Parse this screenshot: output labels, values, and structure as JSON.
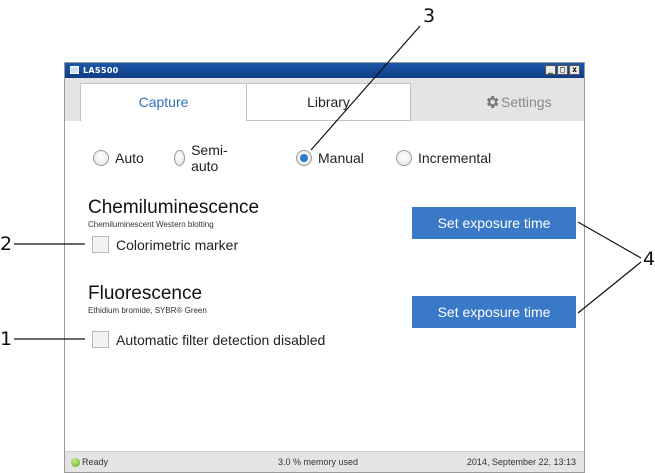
{
  "window": {
    "title": "LAS500",
    "controls": [
      "_",
      "□",
      "x"
    ]
  },
  "tabs": {
    "capture": "Capture",
    "library": "Library",
    "settings": "Settings"
  },
  "modes": {
    "auto": "Auto",
    "semi_auto": "Semi-auto",
    "manual": "Manual",
    "incremental": "Incremental",
    "selected": "Manual"
  },
  "chemi": {
    "title": "Chemiluminescence",
    "subtitle": "Chemiluminescent Western blotting",
    "checkbox_label": "Colorimetric marker",
    "checked": false,
    "button": "Set exposure time"
  },
  "fluor": {
    "title": "Fluorescence",
    "subtitle": "Ethidium bromide, SYBR® Green",
    "checkbox_label": "Automatic filter detection disabled",
    "checked": false,
    "button": "Set exposure time"
  },
  "status": {
    "state": "Ready",
    "memory": "3.0 % memory used",
    "datetime": "2014, September 22, 13:13"
  },
  "callouts": {
    "c1": "1",
    "c2": "2",
    "c3": "3",
    "c4": "4"
  },
  "colors": {
    "accent": "#3a79c7",
    "tab_active_text": "#2f6fb5",
    "status_led": "#5ea51f",
    "titlebar": "#1e56a8"
  },
  "icons": {
    "settings": "gear-icon",
    "status": "status-led-icon",
    "app": "app-icon"
  }
}
